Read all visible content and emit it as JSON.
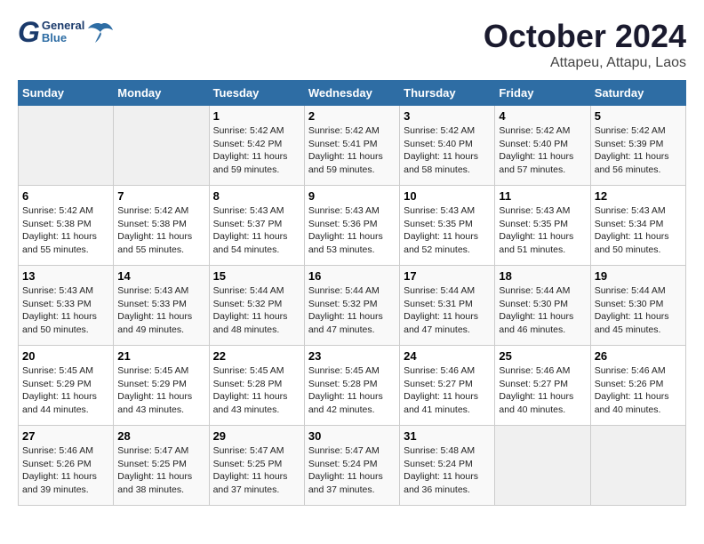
{
  "header": {
    "logo_general": "General",
    "logo_blue": "Blue",
    "month": "October 2024",
    "location": "Attapeu, Attapu, Laos"
  },
  "calendar": {
    "days_of_week": [
      "Sunday",
      "Monday",
      "Tuesday",
      "Wednesday",
      "Thursday",
      "Friday",
      "Saturday"
    ],
    "weeks": [
      [
        {
          "day": "",
          "info": ""
        },
        {
          "day": "",
          "info": ""
        },
        {
          "day": "1",
          "info": "Sunrise: 5:42 AM\nSunset: 5:42 PM\nDaylight: 11 hours and 59 minutes."
        },
        {
          "day": "2",
          "info": "Sunrise: 5:42 AM\nSunset: 5:41 PM\nDaylight: 11 hours and 59 minutes."
        },
        {
          "day": "3",
          "info": "Sunrise: 5:42 AM\nSunset: 5:40 PM\nDaylight: 11 hours and 58 minutes."
        },
        {
          "day": "4",
          "info": "Sunrise: 5:42 AM\nSunset: 5:40 PM\nDaylight: 11 hours and 57 minutes."
        },
        {
          "day": "5",
          "info": "Sunrise: 5:42 AM\nSunset: 5:39 PM\nDaylight: 11 hours and 56 minutes."
        }
      ],
      [
        {
          "day": "6",
          "info": "Sunrise: 5:42 AM\nSunset: 5:38 PM\nDaylight: 11 hours and 55 minutes."
        },
        {
          "day": "7",
          "info": "Sunrise: 5:42 AM\nSunset: 5:38 PM\nDaylight: 11 hours and 55 minutes."
        },
        {
          "day": "8",
          "info": "Sunrise: 5:43 AM\nSunset: 5:37 PM\nDaylight: 11 hours and 54 minutes."
        },
        {
          "day": "9",
          "info": "Sunrise: 5:43 AM\nSunset: 5:36 PM\nDaylight: 11 hours and 53 minutes."
        },
        {
          "day": "10",
          "info": "Sunrise: 5:43 AM\nSunset: 5:35 PM\nDaylight: 11 hours and 52 minutes."
        },
        {
          "day": "11",
          "info": "Sunrise: 5:43 AM\nSunset: 5:35 PM\nDaylight: 11 hours and 51 minutes."
        },
        {
          "day": "12",
          "info": "Sunrise: 5:43 AM\nSunset: 5:34 PM\nDaylight: 11 hours and 50 minutes."
        }
      ],
      [
        {
          "day": "13",
          "info": "Sunrise: 5:43 AM\nSunset: 5:33 PM\nDaylight: 11 hours and 50 minutes."
        },
        {
          "day": "14",
          "info": "Sunrise: 5:43 AM\nSunset: 5:33 PM\nDaylight: 11 hours and 49 minutes."
        },
        {
          "day": "15",
          "info": "Sunrise: 5:44 AM\nSunset: 5:32 PM\nDaylight: 11 hours and 48 minutes."
        },
        {
          "day": "16",
          "info": "Sunrise: 5:44 AM\nSunset: 5:32 PM\nDaylight: 11 hours and 47 minutes."
        },
        {
          "day": "17",
          "info": "Sunrise: 5:44 AM\nSunset: 5:31 PM\nDaylight: 11 hours and 47 minutes."
        },
        {
          "day": "18",
          "info": "Sunrise: 5:44 AM\nSunset: 5:30 PM\nDaylight: 11 hours and 46 minutes."
        },
        {
          "day": "19",
          "info": "Sunrise: 5:44 AM\nSunset: 5:30 PM\nDaylight: 11 hours and 45 minutes."
        }
      ],
      [
        {
          "day": "20",
          "info": "Sunrise: 5:45 AM\nSunset: 5:29 PM\nDaylight: 11 hours and 44 minutes."
        },
        {
          "day": "21",
          "info": "Sunrise: 5:45 AM\nSunset: 5:29 PM\nDaylight: 11 hours and 43 minutes."
        },
        {
          "day": "22",
          "info": "Sunrise: 5:45 AM\nSunset: 5:28 PM\nDaylight: 11 hours and 43 minutes."
        },
        {
          "day": "23",
          "info": "Sunrise: 5:45 AM\nSunset: 5:28 PM\nDaylight: 11 hours and 42 minutes."
        },
        {
          "day": "24",
          "info": "Sunrise: 5:46 AM\nSunset: 5:27 PM\nDaylight: 11 hours and 41 minutes."
        },
        {
          "day": "25",
          "info": "Sunrise: 5:46 AM\nSunset: 5:27 PM\nDaylight: 11 hours and 40 minutes."
        },
        {
          "day": "26",
          "info": "Sunrise: 5:46 AM\nSunset: 5:26 PM\nDaylight: 11 hours and 40 minutes."
        }
      ],
      [
        {
          "day": "27",
          "info": "Sunrise: 5:46 AM\nSunset: 5:26 PM\nDaylight: 11 hours and 39 minutes."
        },
        {
          "day": "28",
          "info": "Sunrise: 5:47 AM\nSunset: 5:25 PM\nDaylight: 11 hours and 38 minutes."
        },
        {
          "day": "29",
          "info": "Sunrise: 5:47 AM\nSunset: 5:25 PM\nDaylight: 11 hours and 37 minutes."
        },
        {
          "day": "30",
          "info": "Sunrise: 5:47 AM\nSunset: 5:24 PM\nDaylight: 11 hours and 37 minutes."
        },
        {
          "day": "31",
          "info": "Sunrise: 5:48 AM\nSunset: 5:24 PM\nDaylight: 11 hours and 36 minutes."
        },
        {
          "day": "",
          "info": ""
        },
        {
          "day": "",
          "info": ""
        }
      ]
    ]
  }
}
